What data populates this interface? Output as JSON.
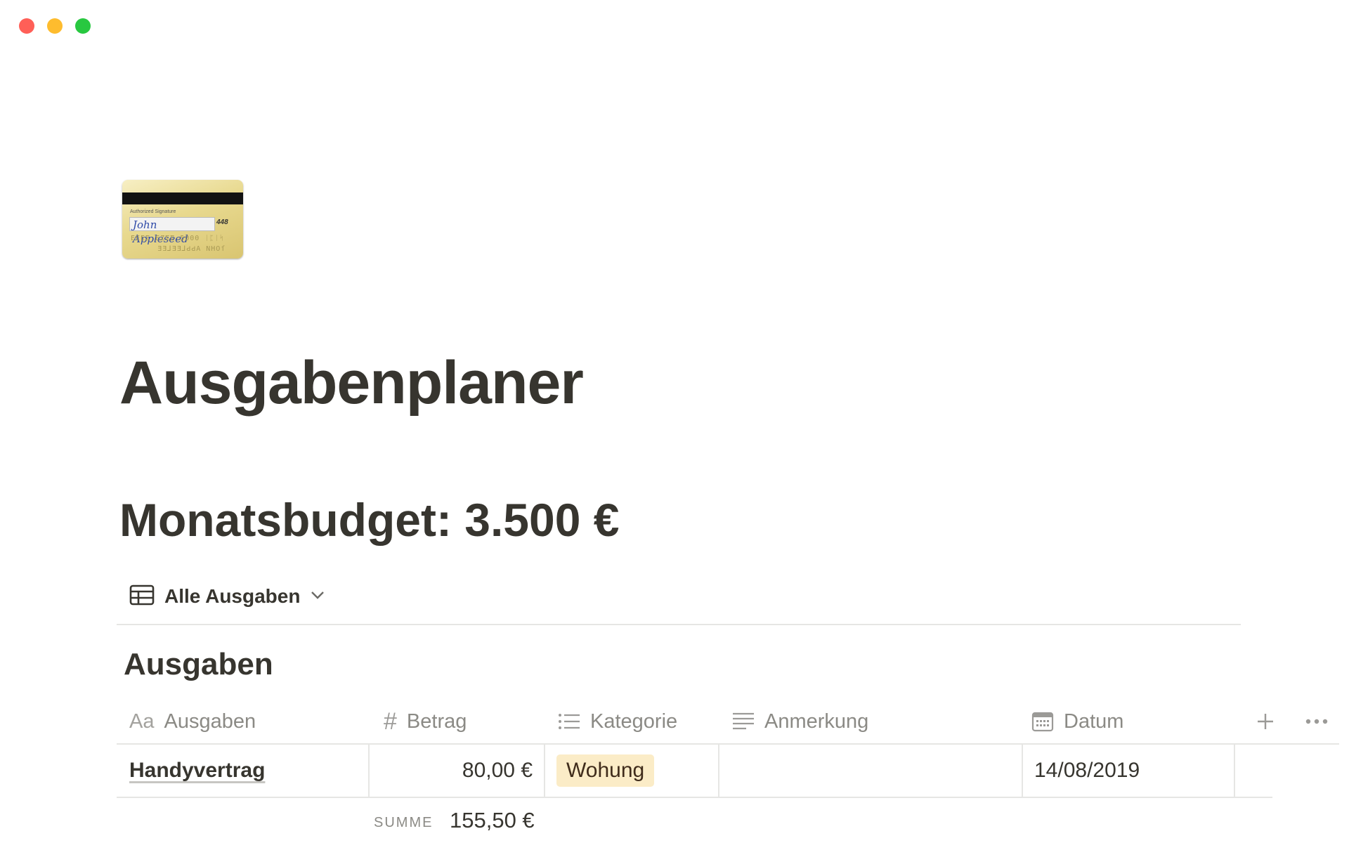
{
  "page": {
    "title": "Ausgabenplaner",
    "budget_heading": "Monatsbudget: 3.500 €",
    "icon": {
      "name": "credit-card-icon",
      "signature_label": "Authorized Signature",
      "signature": "John Appleseed",
      "cvv": "448",
      "embossed_line1": "EEEΣ EZΣΣ 5000 ᛁᛈᛁᛋ",
      "embossed_line2": "ƎƎ⅃ƎƎ⅃ԀԀA NHOſ"
    }
  },
  "view": {
    "label": "Alle Ausgaben",
    "icon": "table-icon",
    "chevron": "chevron-down-icon"
  },
  "database": {
    "title": "Ausgaben",
    "columns": [
      {
        "label": "Ausgaben",
        "icon": "text-aa-icon"
      },
      {
        "label": "Betrag",
        "icon": "number-hash-icon"
      },
      {
        "label": "Kategorie",
        "icon": "list-icon"
      },
      {
        "label": "Anmerkung",
        "icon": "text-lines-icon"
      },
      {
        "label": "Datum",
        "icon": "calendar-icon"
      }
    ],
    "rows": [
      {
        "name": "Handyvertrag",
        "amount": "80,00 €",
        "category": "Wohung",
        "note": "",
        "date": "14/08/2019"
      }
    ],
    "sum_label": "SUMME",
    "sum_value": "155,50 €",
    "category_colors": {
      "Wohung": "#fbecc7"
    }
  }
}
